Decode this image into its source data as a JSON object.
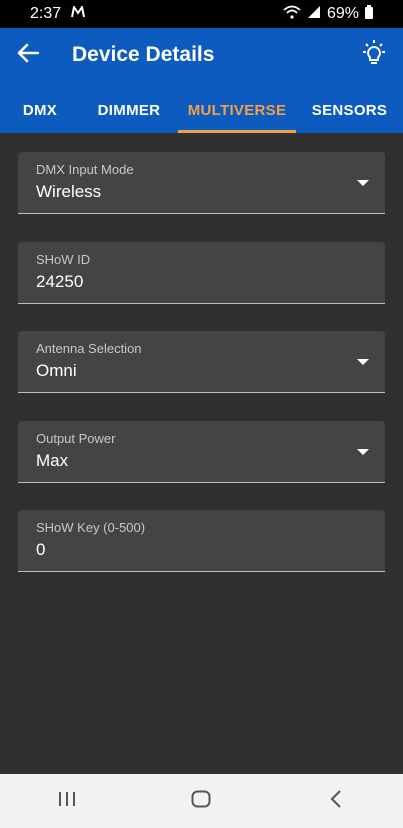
{
  "status_bar": {
    "time": "2:37",
    "battery": "69%",
    "icons": [
      "notification-m-icon",
      "wifi-icon",
      "signal-icon",
      "battery-icon"
    ]
  },
  "app_bar": {
    "title": "Device Details",
    "back_icon": "arrow-left-icon",
    "action_icon": "lightbulb-icon",
    "color": "#0d5bbf"
  },
  "tabs": [
    {
      "label": "DMX",
      "active": false
    },
    {
      "label": "DIMMER",
      "active": false
    },
    {
      "label": "MULTIVERSE",
      "active": true
    },
    {
      "label": "SENSORS",
      "active": false
    }
  ],
  "accent_color": "#f0a24a",
  "fields": [
    {
      "label": "DMX Input Mode",
      "value": "Wireless",
      "type": "dropdown"
    },
    {
      "label": "SHoW ID",
      "value": "24250",
      "type": "text"
    },
    {
      "label": "Antenna Selection",
      "value": "Omni",
      "type": "dropdown"
    },
    {
      "label": "Output Power",
      "value": "Max",
      "type": "dropdown"
    },
    {
      "label": "SHoW Key (0-500)",
      "value": "0",
      "type": "text"
    }
  ],
  "nav_bar": {
    "icons": [
      "recent-apps-icon",
      "home-icon",
      "back-icon"
    ]
  }
}
